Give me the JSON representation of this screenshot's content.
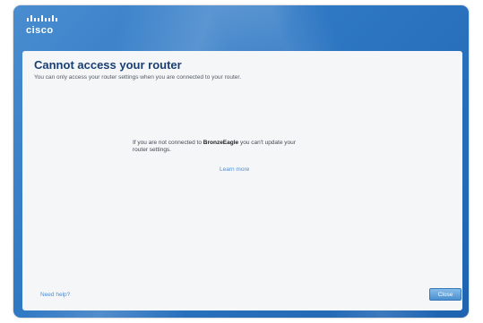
{
  "brand": {
    "logo_text": "cisco",
    "icon": "cisco-logo-icon"
  },
  "dialog": {
    "title": "Cannot access your router",
    "subtitle": "You can only access your router settings when you are connected to your router.",
    "message_prefix": "If you are not connected to ",
    "network_name": "BronzeEagle",
    "message_suffix": " you can't update your router settings.",
    "learn_more_label": "Learn more",
    "help_link_label": "Need help?",
    "close_label": "Close"
  },
  "colors": {
    "frame_blue": "#2f78c4",
    "panel_background": "#f4f6f8",
    "title_text": "#1b3f73",
    "link": "#4a90d9",
    "button_blue": "#4b8fd0"
  }
}
